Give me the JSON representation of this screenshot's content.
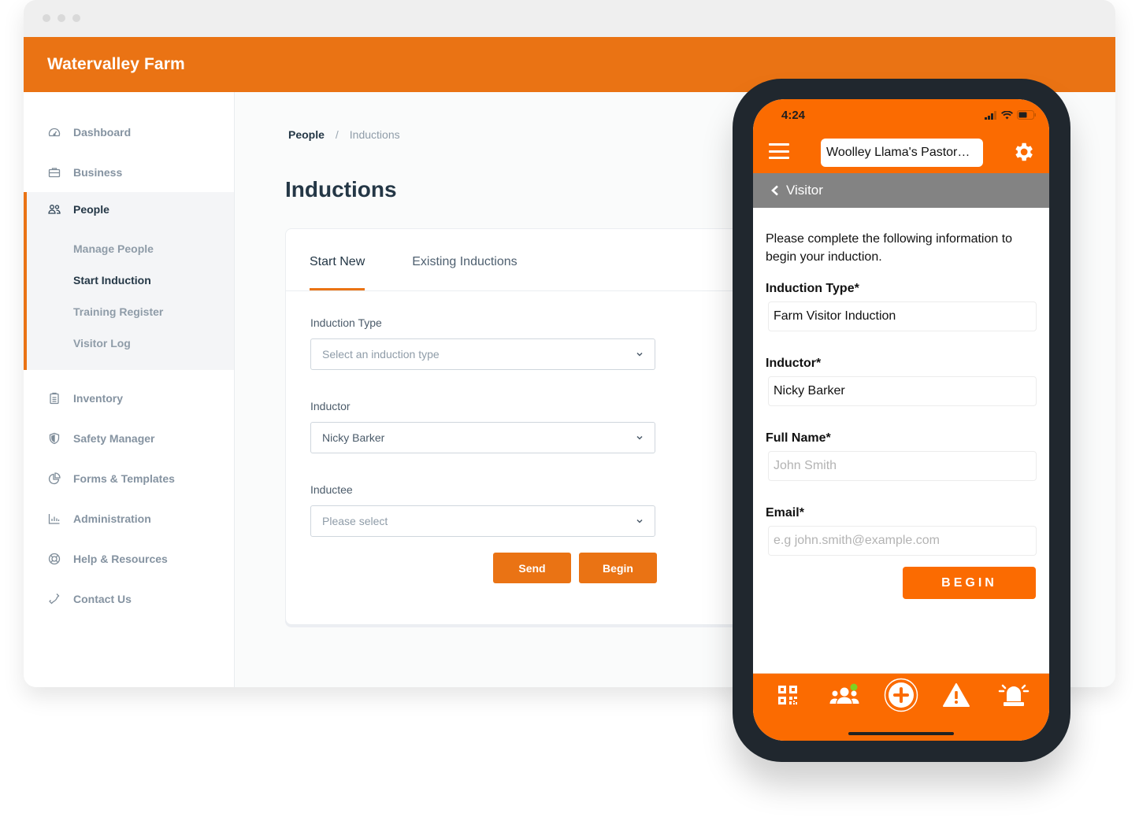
{
  "browser": {
    "app_title": "Watervalley Farm"
  },
  "sidebar": {
    "items": [
      {
        "label": "Dashboard",
        "icon": "dashboard-gauge-icon"
      },
      {
        "label": "Business",
        "icon": "briefcase-icon"
      },
      {
        "label": "People",
        "icon": "people-icon",
        "expanded": true,
        "children": [
          {
            "label": "Manage People",
            "active": false
          },
          {
            "label": "Start Induction",
            "active": true
          },
          {
            "label": "Training Register",
            "active": false
          },
          {
            "label": "Visitor Log",
            "active": false
          }
        ]
      },
      {
        "label": "Inventory",
        "icon": "clipboard-icon"
      },
      {
        "label": "Safety Manager",
        "icon": "shield-icon"
      },
      {
        "label": "Forms & Templates",
        "icon": "pie-chart-icon"
      },
      {
        "label": "Administration",
        "icon": "bar-chart-icon"
      },
      {
        "label": "Help & Resources",
        "icon": "lifebuoy-icon"
      },
      {
        "label": "Contact Us",
        "icon": "phone-icon"
      }
    ]
  },
  "main": {
    "breadcrumb": {
      "parent": "People",
      "separator": "/",
      "current": "Inductions"
    },
    "title": "Inductions",
    "tabs": [
      {
        "label": "Start New",
        "active": true
      },
      {
        "label": "Existing Inductions",
        "active": false
      }
    ],
    "form": {
      "induction_type": {
        "label": "Induction Type",
        "value": "",
        "placeholder": "Select an induction type"
      },
      "inductor": {
        "label": "Inductor",
        "value": "Nicky Barker",
        "placeholder": ""
      },
      "inductee": {
        "label": "Inductee",
        "value": "",
        "placeholder": "Please select"
      },
      "send_label": "Send",
      "begin_label": "Begin"
    }
  },
  "phone": {
    "status": {
      "time": "4:24"
    },
    "org_name": "Woolley Llama's Pastor…",
    "back_label": "Visitor",
    "intro": "Please complete the following information to begin your induction.",
    "fields": [
      {
        "label": "Induction Type*",
        "value": "Farm Visitor Induction",
        "placeholder": ""
      },
      {
        "label": "Inductor*",
        "value": "Nicky Barker",
        "placeholder": ""
      },
      {
        "label": "Full Name*",
        "value": "",
        "placeholder": "John Smith"
      },
      {
        "label": "Email*",
        "value": "",
        "placeholder": "e.g john.smith@example.com"
      }
    ],
    "begin_label": "BEGIN",
    "bottom_tabs": [
      {
        "icon": "qr-code-icon"
      },
      {
        "icon": "group-icon",
        "badge": true,
        "badge_color": "#7ed321"
      },
      {
        "icon": "add-circle-icon"
      },
      {
        "icon": "warning-icon"
      },
      {
        "icon": "alarm-siren-icon"
      }
    ]
  },
  "colors": {
    "brand_orange": "#ea7314",
    "phone_orange": "#fb6b01",
    "text_dark": "#243746",
    "text_muted": "#8593a1",
    "badge_green": "#7ed321"
  }
}
